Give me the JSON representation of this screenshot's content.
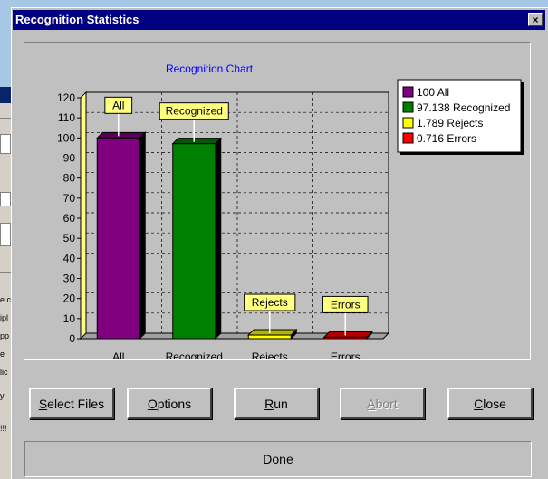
{
  "window": {
    "title": "Recognition Statistics",
    "close_label": "×"
  },
  "background_fragments": [
    "e c",
    "ipl",
    "pp",
    "e",
    "lic",
    "y",
    "!!!"
  ],
  "chart_data": {
    "type": "bar",
    "title": "Recognition Chart",
    "categories": [
      "All",
      "Recognized",
      "Rejects",
      "Errors"
    ],
    "values": [
      100,
      97.138,
      1.789,
      0.716
    ],
    "colors": [
      "#800080",
      "#008000",
      "#ffff00",
      "#ff0000"
    ],
    "callouts": [
      "All",
      "Recognized",
      "Rejects",
      "Errors"
    ],
    "legend": [
      "100 All",
      "97.138 Recognized",
      "1.789 Rejects",
      "0.716 Errors"
    ],
    "legend_position": "top-right",
    "ylim": [
      0,
      120
    ],
    "yticks": [
      0,
      10,
      20,
      30,
      40,
      50,
      60,
      70,
      80,
      90,
      100,
      110,
      120
    ],
    "grid": true,
    "style": "3d"
  },
  "buttons": [
    {
      "pre": "",
      "hot": "S",
      "post": "elect Files",
      "enabled": true
    },
    {
      "pre": "",
      "hot": "O",
      "post": "ptions",
      "enabled": true
    },
    {
      "pre": "",
      "hot": "R",
      "post": "un",
      "enabled": true
    },
    {
      "pre": "",
      "hot": "A",
      "post": "bort",
      "enabled": false
    },
    {
      "pre": "",
      "hot": "C",
      "post": "lose",
      "enabled": true
    }
  ],
  "status": {
    "text": "Done"
  }
}
